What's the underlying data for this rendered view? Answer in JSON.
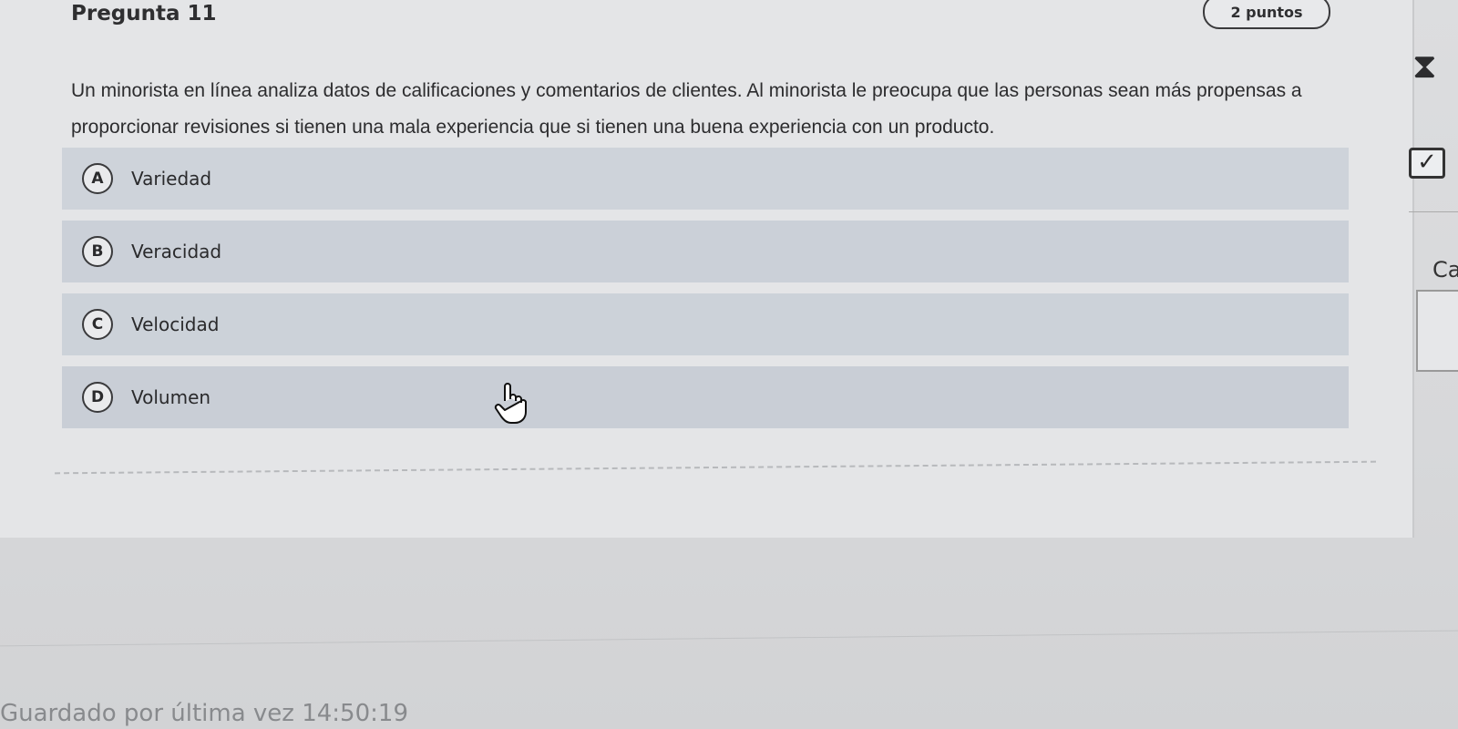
{
  "question": {
    "title": "Pregunta 11",
    "points": "2 puntos",
    "text": "Un minorista en línea analiza datos de calificaciones y comentarios de clientes. Al minorista le preocupa que las personas sean más propensas a proporcionar revisiones si tienen una mala experiencia que si tienen una buena experiencia con un producto.",
    "options": [
      {
        "letter": "A",
        "label": "Variedad"
      },
      {
        "letter": "B",
        "label": "Veracidad"
      },
      {
        "letter": "C",
        "label": "Velocidad"
      },
      {
        "letter": "D",
        "label": "Volumen"
      }
    ]
  },
  "sidebar": {
    "hourglass_icon": "hourglass-icon",
    "check_icon": "checkbox-checked-icon",
    "partial_text": "Ca"
  },
  "footer": {
    "partial_text": "Guardado por última vez 14:50:19"
  }
}
